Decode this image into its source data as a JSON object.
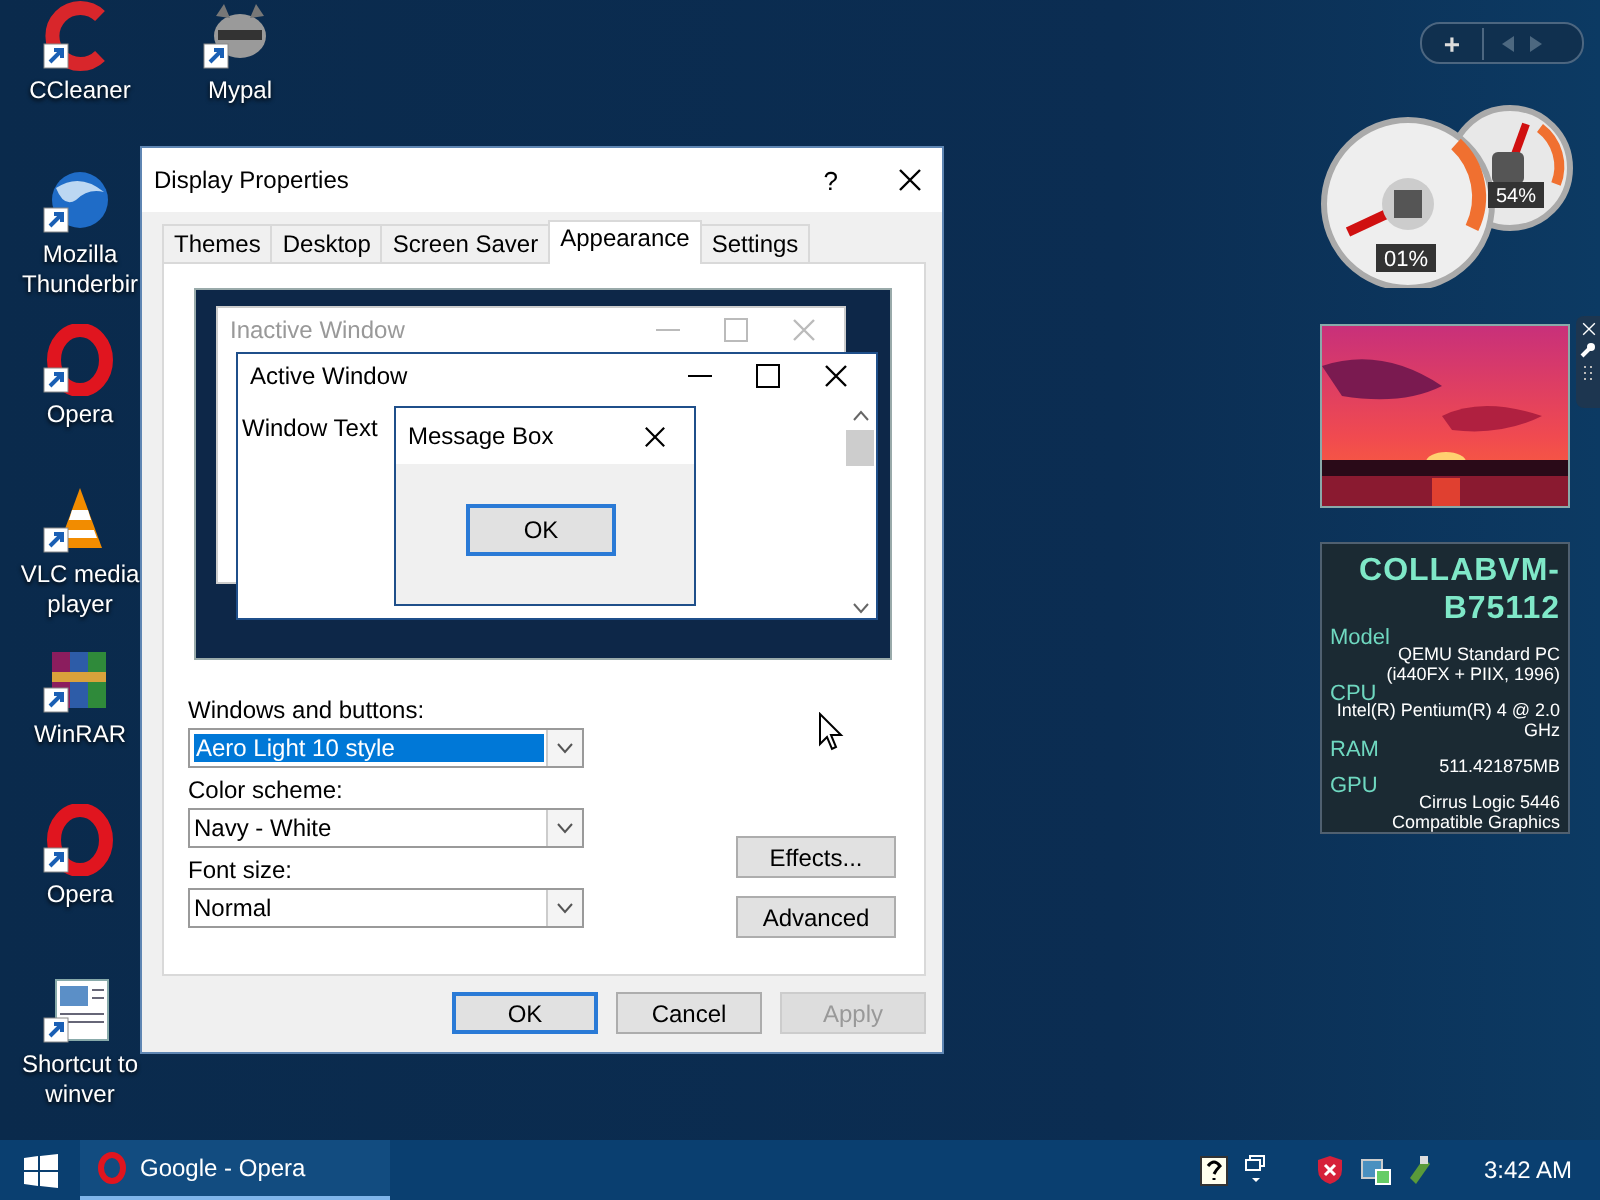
{
  "desktop_icons": [
    {
      "label": "CCleaner",
      "kind": "cshape"
    },
    {
      "label": "Mypal",
      "kind": "animal"
    },
    {
      "label": "Mozilla Thunderbir",
      "kind": "globe"
    },
    {
      "label": "Opera",
      "kind": "ring"
    },
    {
      "label": "VLC media player",
      "kind": "cone"
    },
    {
      "label": "WinRAR",
      "kind": "books"
    },
    {
      "label": "Opera",
      "kind": "ring"
    },
    {
      "label": "Shortcut to winver",
      "kind": "window"
    }
  ],
  "dialog": {
    "title": "Display Properties",
    "help": "?",
    "tabs": [
      {
        "label": "Themes",
        "selected": false
      },
      {
        "label": "Desktop",
        "selected": false
      },
      {
        "label": "Screen Saver",
        "selected": false
      },
      {
        "label": "Appearance",
        "selected": true
      },
      {
        "label": "Settings",
        "selected": false
      }
    ],
    "preview": {
      "inactive_title": "Inactive Window",
      "active_title": "Active Window",
      "window_text": "Window Text",
      "message_title": "Message Box",
      "message_button": "OK"
    },
    "fields": [
      {
        "label": "Windows and buttons:",
        "value": "Aero Light 10 style",
        "selected": true
      },
      {
        "label": "Color scheme:",
        "value": "Navy - White",
        "selected": false
      },
      {
        "label": "Font size:",
        "value": "Normal",
        "selected": false
      }
    ],
    "side_buttons": [
      "Effects...",
      "Advanced"
    ],
    "buttons": [
      {
        "label": "OK",
        "default": true,
        "disabled": false
      },
      {
        "label": "Cancel",
        "default": false,
        "disabled": false
      },
      {
        "label": "Apply",
        "default": false,
        "disabled": true
      }
    ]
  },
  "gadget_bar": {
    "add": "+"
  },
  "gauges": [
    {
      "reading": "01%"
    },
    {
      "reading": "54%"
    }
  ],
  "system_info": {
    "hostname": "COLLABVM-B75112",
    "rows": [
      {
        "label": "Model",
        "value": "QEMU Standard PC (i440FX + PIIX, 1996)"
      },
      {
        "label": "CPU",
        "value": "Intel(R) Pentium(R) 4 @ 2.0 GHz"
      },
      {
        "label": "RAM",
        "value": "511.421875MB"
      },
      {
        "label": "GPU",
        "value": "Cirrus Logic 5446 Compatible Graphics"
      }
    ]
  },
  "taskbar": {
    "tasks": [
      {
        "label": "Google - Opera",
        "selected": true
      }
    ],
    "clock": "3:42 AM"
  }
}
